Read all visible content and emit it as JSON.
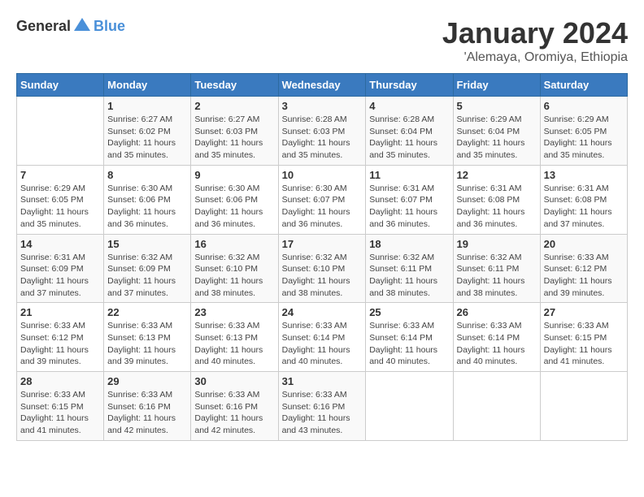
{
  "logo": {
    "general": "General",
    "blue": "Blue"
  },
  "title": "January 2024",
  "subtitle": "'Alemaya, Oromiya, Ethiopia",
  "weekdays": [
    "Sunday",
    "Monday",
    "Tuesday",
    "Wednesday",
    "Thursday",
    "Friday",
    "Saturday"
  ],
  "weeks": [
    [
      {
        "day": "",
        "sunrise": "",
        "sunset": "",
        "daylight": ""
      },
      {
        "day": "1",
        "sunrise": "Sunrise: 6:27 AM",
        "sunset": "Sunset: 6:02 PM",
        "daylight": "Daylight: 11 hours and 35 minutes."
      },
      {
        "day": "2",
        "sunrise": "Sunrise: 6:27 AM",
        "sunset": "Sunset: 6:03 PM",
        "daylight": "Daylight: 11 hours and 35 minutes."
      },
      {
        "day": "3",
        "sunrise": "Sunrise: 6:28 AM",
        "sunset": "Sunset: 6:03 PM",
        "daylight": "Daylight: 11 hours and 35 minutes."
      },
      {
        "day": "4",
        "sunrise": "Sunrise: 6:28 AM",
        "sunset": "Sunset: 6:04 PM",
        "daylight": "Daylight: 11 hours and 35 minutes."
      },
      {
        "day": "5",
        "sunrise": "Sunrise: 6:29 AM",
        "sunset": "Sunset: 6:04 PM",
        "daylight": "Daylight: 11 hours and 35 minutes."
      },
      {
        "day": "6",
        "sunrise": "Sunrise: 6:29 AM",
        "sunset": "Sunset: 6:05 PM",
        "daylight": "Daylight: 11 hours and 35 minutes."
      }
    ],
    [
      {
        "day": "7",
        "sunrise": "Sunrise: 6:29 AM",
        "sunset": "Sunset: 6:05 PM",
        "daylight": "Daylight: 11 hours and 35 minutes."
      },
      {
        "day": "8",
        "sunrise": "Sunrise: 6:30 AM",
        "sunset": "Sunset: 6:06 PM",
        "daylight": "Daylight: 11 hours and 36 minutes."
      },
      {
        "day": "9",
        "sunrise": "Sunrise: 6:30 AM",
        "sunset": "Sunset: 6:06 PM",
        "daylight": "Daylight: 11 hours and 36 minutes."
      },
      {
        "day": "10",
        "sunrise": "Sunrise: 6:30 AM",
        "sunset": "Sunset: 6:07 PM",
        "daylight": "Daylight: 11 hours and 36 minutes."
      },
      {
        "day": "11",
        "sunrise": "Sunrise: 6:31 AM",
        "sunset": "Sunset: 6:07 PM",
        "daylight": "Daylight: 11 hours and 36 minutes."
      },
      {
        "day": "12",
        "sunrise": "Sunrise: 6:31 AM",
        "sunset": "Sunset: 6:08 PM",
        "daylight": "Daylight: 11 hours and 36 minutes."
      },
      {
        "day": "13",
        "sunrise": "Sunrise: 6:31 AM",
        "sunset": "Sunset: 6:08 PM",
        "daylight": "Daylight: 11 hours and 37 minutes."
      }
    ],
    [
      {
        "day": "14",
        "sunrise": "Sunrise: 6:31 AM",
        "sunset": "Sunset: 6:09 PM",
        "daylight": "Daylight: 11 hours and 37 minutes."
      },
      {
        "day": "15",
        "sunrise": "Sunrise: 6:32 AM",
        "sunset": "Sunset: 6:09 PM",
        "daylight": "Daylight: 11 hours and 37 minutes."
      },
      {
        "day": "16",
        "sunrise": "Sunrise: 6:32 AM",
        "sunset": "Sunset: 6:10 PM",
        "daylight": "Daylight: 11 hours and 38 minutes."
      },
      {
        "day": "17",
        "sunrise": "Sunrise: 6:32 AM",
        "sunset": "Sunset: 6:10 PM",
        "daylight": "Daylight: 11 hours and 38 minutes."
      },
      {
        "day": "18",
        "sunrise": "Sunrise: 6:32 AM",
        "sunset": "Sunset: 6:11 PM",
        "daylight": "Daylight: 11 hours and 38 minutes."
      },
      {
        "day": "19",
        "sunrise": "Sunrise: 6:32 AM",
        "sunset": "Sunset: 6:11 PM",
        "daylight": "Daylight: 11 hours and 38 minutes."
      },
      {
        "day": "20",
        "sunrise": "Sunrise: 6:33 AM",
        "sunset": "Sunset: 6:12 PM",
        "daylight": "Daylight: 11 hours and 39 minutes."
      }
    ],
    [
      {
        "day": "21",
        "sunrise": "Sunrise: 6:33 AM",
        "sunset": "Sunset: 6:12 PM",
        "daylight": "Daylight: 11 hours and 39 minutes."
      },
      {
        "day": "22",
        "sunrise": "Sunrise: 6:33 AM",
        "sunset": "Sunset: 6:13 PM",
        "daylight": "Daylight: 11 hours and 39 minutes."
      },
      {
        "day": "23",
        "sunrise": "Sunrise: 6:33 AM",
        "sunset": "Sunset: 6:13 PM",
        "daylight": "Daylight: 11 hours and 40 minutes."
      },
      {
        "day": "24",
        "sunrise": "Sunrise: 6:33 AM",
        "sunset": "Sunset: 6:14 PM",
        "daylight": "Daylight: 11 hours and 40 minutes."
      },
      {
        "day": "25",
        "sunrise": "Sunrise: 6:33 AM",
        "sunset": "Sunset: 6:14 PM",
        "daylight": "Daylight: 11 hours and 40 minutes."
      },
      {
        "day": "26",
        "sunrise": "Sunrise: 6:33 AM",
        "sunset": "Sunset: 6:14 PM",
        "daylight": "Daylight: 11 hours and 40 minutes."
      },
      {
        "day": "27",
        "sunrise": "Sunrise: 6:33 AM",
        "sunset": "Sunset: 6:15 PM",
        "daylight": "Daylight: 11 hours and 41 minutes."
      }
    ],
    [
      {
        "day": "28",
        "sunrise": "Sunrise: 6:33 AM",
        "sunset": "Sunset: 6:15 PM",
        "daylight": "Daylight: 11 hours and 41 minutes."
      },
      {
        "day": "29",
        "sunrise": "Sunrise: 6:33 AM",
        "sunset": "Sunset: 6:16 PM",
        "daylight": "Daylight: 11 hours and 42 minutes."
      },
      {
        "day": "30",
        "sunrise": "Sunrise: 6:33 AM",
        "sunset": "Sunset: 6:16 PM",
        "daylight": "Daylight: 11 hours and 42 minutes."
      },
      {
        "day": "31",
        "sunrise": "Sunrise: 6:33 AM",
        "sunset": "Sunset: 6:16 PM",
        "daylight": "Daylight: 11 hours and 43 minutes."
      },
      {
        "day": "",
        "sunrise": "",
        "sunset": "",
        "daylight": ""
      },
      {
        "day": "",
        "sunrise": "",
        "sunset": "",
        "daylight": ""
      },
      {
        "day": "",
        "sunrise": "",
        "sunset": "",
        "daylight": ""
      }
    ]
  ]
}
